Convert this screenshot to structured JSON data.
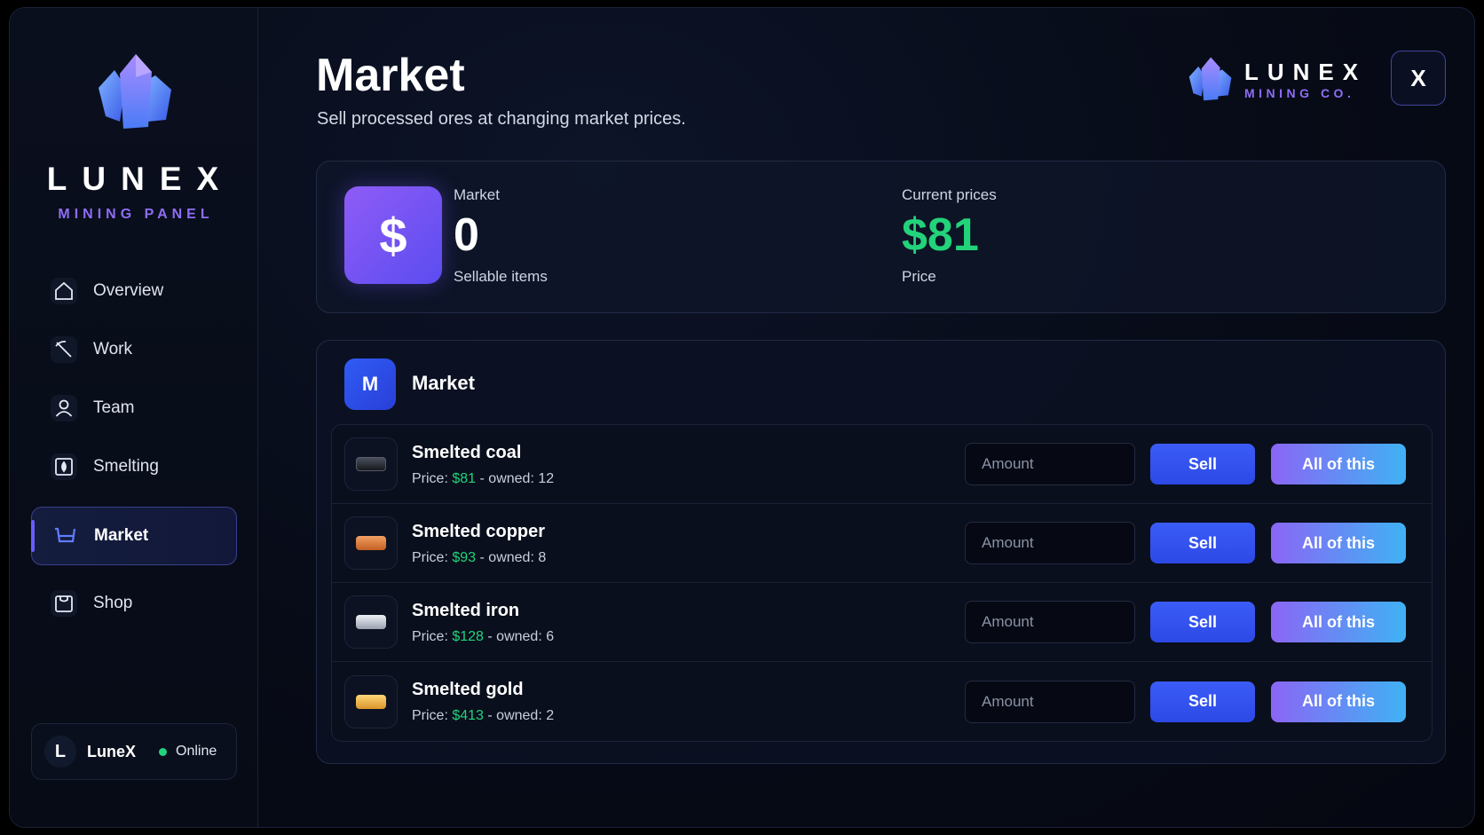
{
  "brand": {
    "title": "LUNEX",
    "subtitle": "MINING PANEL",
    "corner_title": "LUNEX",
    "corner_subtitle": "MINING CO."
  },
  "sidebar": {
    "items": [
      {
        "label": "Overview",
        "icon": "home-icon",
        "active": false
      },
      {
        "label": "Work",
        "icon": "pickaxe-icon",
        "active": false
      },
      {
        "label": "Team",
        "icon": "user-icon",
        "active": false
      },
      {
        "label": "Smelting",
        "icon": "furnace-icon",
        "active": false
      },
      {
        "label": "Market",
        "icon": "cart-icon",
        "active": true
      },
      {
        "label": "Shop",
        "icon": "bag-icon",
        "active": false
      }
    ],
    "user": {
      "initial": "L",
      "name": "LuneX",
      "status": "Online"
    }
  },
  "header": {
    "title": "Market",
    "subtitle": "Sell processed ores at changing market prices.",
    "close_label": "X"
  },
  "stats": {
    "icon_glyph": "$",
    "sellable": {
      "label": "Market",
      "value": "0",
      "caption": "Sellable items"
    },
    "price": {
      "label": "Current prices",
      "value": "$81",
      "caption": "Price"
    }
  },
  "market": {
    "badge": "M",
    "title": "Market",
    "price_prefix": "Price:",
    "owned_prefix": "- owned:",
    "amount_placeholder": "Amount",
    "sell_label": "Sell",
    "all_label": "All of this",
    "items": [
      {
        "name": "Smelted coal",
        "price": "$81",
        "owned": "12",
        "color": "#2a2e38"
      },
      {
        "name": "Smelted copper",
        "price": "$93",
        "owned": "8",
        "color": "#d9773a"
      },
      {
        "name": "Smelted iron",
        "price": "$128",
        "owned": "6",
        "color": "#c9ced8"
      },
      {
        "name": "Smelted gold",
        "price": "$413",
        "owned": "2",
        "color": "#f0b53c"
      }
    ]
  },
  "colors": {
    "accent": "#6a5cff",
    "green": "#22d37a",
    "brand_purple": "#8e6df5"
  }
}
